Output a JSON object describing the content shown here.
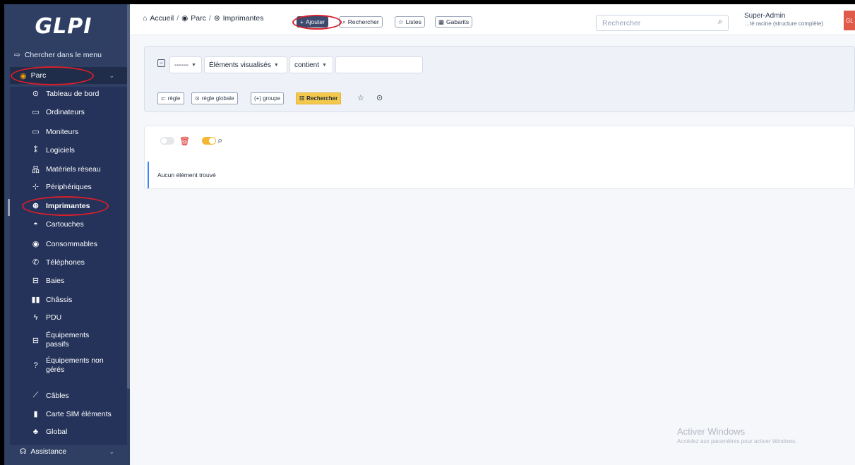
{
  "app": {
    "logo": "GLPI"
  },
  "sidebar": {
    "search_label": "Chercher dans le menu",
    "section_parc": "Parc",
    "items": [
      {
        "label": "Tableau de bord",
        "icon": "dashboard-icon",
        "glyph": "⊙"
      },
      {
        "label": "Ordinateurs",
        "icon": "computer-icon",
        "glyph": "▭"
      },
      {
        "label": "Moniteurs",
        "icon": "monitor-icon",
        "glyph": "▭"
      },
      {
        "label": "Logiciels",
        "icon": "software-icon",
        "glyph": "⁑"
      },
      {
        "label": "Matériels réseau",
        "icon": "network-icon",
        "glyph": "品"
      },
      {
        "label": "Périphériques",
        "icon": "peripheral-icon",
        "glyph": "⊹"
      },
      {
        "label": "Imprimantes",
        "icon": "printer-icon",
        "glyph": "⊛"
      },
      {
        "label": "Cartouches",
        "icon": "cartridge-icon",
        "glyph": "◓"
      },
      {
        "label": "Consommables",
        "icon": "consumable-icon",
        "glyph": "◉"
      },
      {
        "label": "Téléphones",
        "icon": "phone-icon",
        "glyph": "✆"
      },
      {
        "label": "Baies",
        "icon": "rack-icon",
        "glyph": "⊟"
      },
      {
        "label": "Châssis",
        "icon": "chassis-icon",
        "glyph": "▮▮"
      },
      {
        "label": "PDU",
        "icon": "pdu-icon",
        "glyph": "ϟ"
      },
      {
        "label": "Équipements passifs",
        "icon": "passive-icon",
        "glyph": "⊟"
      },
      {
        "label": "Équipements non gérés",
        "icon": "unmanaged-icon",
        "glyph": "?"
      },
      {
        "label": "Câbles",
        "icon": "cable-icon",
        "glyph": "⟋"
      },
      {
        "label": "Carte SIM éléments",
        "icon": "sim-icon",
        "glyph": "▮"
      },
      {
        "label": "Global",
        "icon": "global-icon",
        "glyph": "♣"
      }
    ],
    "section_assistance": "Assistance"
  },
  "breadcrumb": {
    "home": "Accueil",
    "parc": "Parc",
    "current": "Imprimantes"
  },
  "toolbar": {
    "add": "Ajouter",
    "search": "Rechercher",
    "lists": "Listes",
    "templates": "Gabarits"
  },
  "global_search": {
    "placeholder": "Rechercher"
  },
  "user": {
    "name": "Super-Admin",
    "entity": "…té racine (structure complète)",
    "avatar": "GL"
  },
  "criteria": {
    "field_link": "------",
    "field": "Éléments visualisés",
    "operator": "contient",
    "value": "",
    "btn_rule": "règle",
    "btn_global_rule": "règle globale",
    "btn_group": "(+) groupe",
    "btn_search": "Rechercher"
  },
  "results": {
    "empty_message": "Aucun élément trouvé"
  },
  "watermark": {
    "title": "Activer Windows",
    "subtitle": "Accédez aux paramètres pour activer Windows."
  },
  "colors": {
    "sidebar_bg": "#2f3f64",
    "accent_yellow": "#f2c94c",
    "annotation_red": "#d61f2a",
    "primary_button": "#3d4a6e"
  }
}
